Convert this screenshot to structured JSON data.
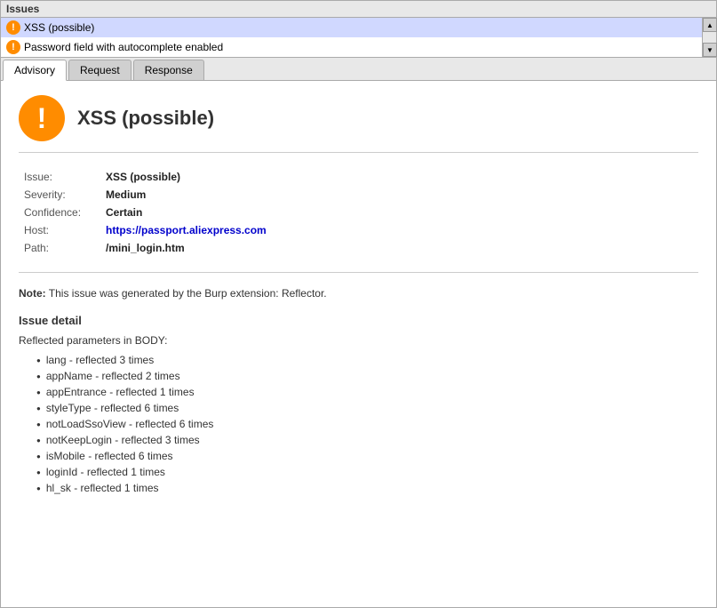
{
  "issues_panel": {
    "title": "Issues",
    "issue_list": [
      {
        "id": 1,
        "label": "XSS (possible)",
        "selected": true
      },
      {
        "id": 2,
        "label": "Password field with autocomplete enabled",
        "selected": false
      }
    ]
  },
  "tabs": [
    {
      "id": "advisory",
      "label": "Advisory",
      "active": true
    },
    {
      "id": "request",
      "label": "Request",
      "active": false
    },
    {
      "id": "response",
      "label": "Response",
      "active": false
    }
  ],
  "advisory": {
    "main_title": "XSS (possible)",
    "details": {
      "issue_label": "Issue:",
      "issue_value": "XSS (possible)",
      "severity_label": "Severity:",
      "severity_value": "Medium",
      "confidence_label": "Confidence:",
      "confidence_value": "Certain",
      "host_label": "Host:",
      "host_value": "https://passport.aliexpress.com",
      "path_label": "Path:",
      "path_value": "/mini_login.htm"
    },
    "note_prefix": "Note:",
    "note_text": " This issue was generated by the Burp extension: Reflector.",
    "issue_detail_title": "Issue detail",
    "reflected_label": "Reflected parameters in BODY:",
    "params": [
      "lang - reflected 3 times",
      "appName - reflected 2 times",
      "appEntrance - reflected 1 times",
      "styleType - reflected 6 times",
      "notLoadSsoView - reflected 6 times",
      "notKeepLogin - reflected 3 times",
      "isMobile - reflected 6 times",
      "loginId - reflected 1 times",
      "hl_sk - reflected 1 times"
    ]
  },
  "icons": {
    "warning": "!",
    "scroll_up": "▲",
    "scroll_down": "▼"
  }
}
